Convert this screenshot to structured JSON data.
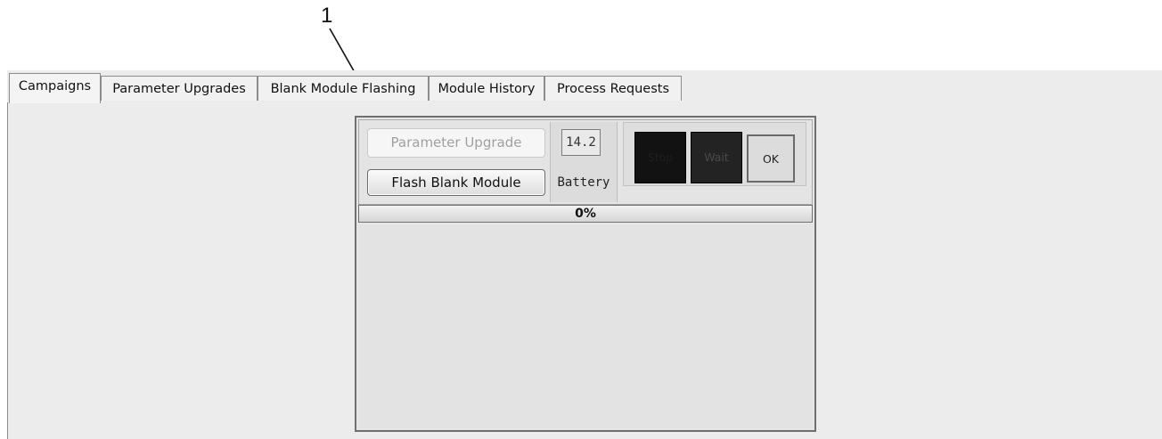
{
  "callout": {
    "number": "1"
  },
  "tabs": [
    {
      "label": "Campaigns",
      "active": true
    },
    {
      "label": "Parameter Upgrades",
      "active": false
    },
    {
      "label": "Blank Module Flashing",
      "active": false
    },
    {
      "label": "Module History",
      "active": false
    },
    {
      "label": "Process Requests",
      "active": false
    }
  ],
  "panel": {
    "parameter_upgrade_label": "Parameter Upgrade",
    "flash_blank_module_label": "Flash Blank Module",
    "battery_value": "14.2",
    "battery_label": "Battery",
    "status_boxes": [
      {
        "label": "Stop",
        "color": "#121212"
      },
      {
        "label": "Wait",
        "color": "#232323"
      },
      {
        "label": "OK",
        "color": "#dcdcdc"
      }
    ],
    "progress": {
      "percent": 0,
      "text": "0%"
    }
  }
}
